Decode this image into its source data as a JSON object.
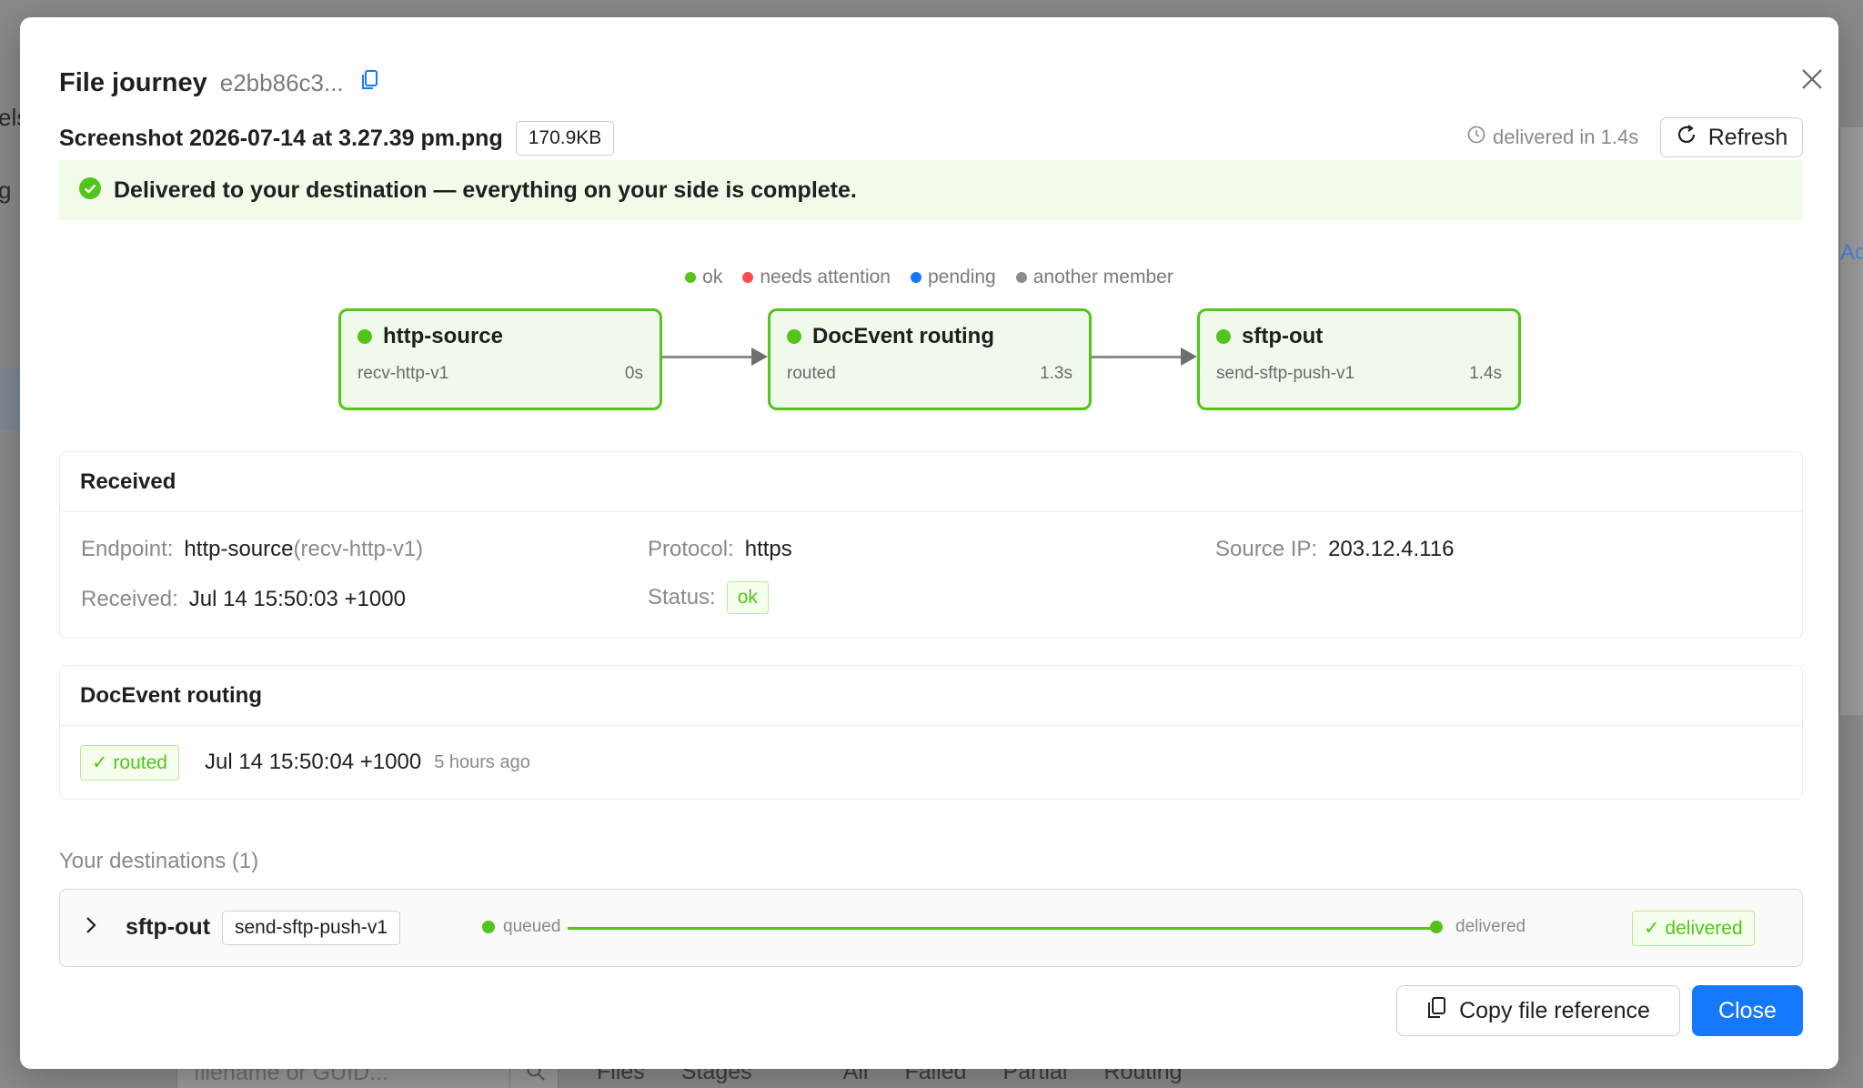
{
  "background": {
    "side_fragments": [
      "els",
      "g"
    ],
    "right_fragment": "Ad",
    "search_placeholder": "filename or GUID...",
    "tabs": [
      "Files",
      "Stages",
      "All",
      "Failed",
      "Partial",
      "Routing"
    ]
  },
  "modal": {
    "title": "File journey",
    "file_id": "e2bb86c3...",
    "file_name": "Screenshot 2026-07-14 at 3.27.39 pm.png",
    "file_size": "170.9KB",
    "delivered_in": "delivered in 1.4s",
    "refresh_label": "Refresh",
    "banner": "Delivered to your destination — everything on your side is complete."
  },
  "legend": [
    {
      "label": "ok",
      "color": "#52c41a"
    },
    {
      "label": "needs attention",
      "color": "#ff4d4f"
    },
    {
      "label": "pending",
      "color": "#1677ff"
    },
    {
      "label": "another member",
      "color": "#8c8c8c"
    }
  ],
  "flow": [
    {
      "title": "http-source",
      "subtitle": "recv-http-v1",
      "time": "0s",
      "status_color": "#52c41a"
    },
    {
      "title": "DocEvent routing",
      "subtitle": "routed",
      "time": "1.3s",
      "status_color": "#52c41a"
    },
    {
      "title": "sftp-out",
      "subtitle": "send-sftp-push-v1",
      "time": "1.4s",
      "status_color": "#52c41a"
    }
  ],
  "received": {
    "heading": "Received",
    "endpoint_label": "Endpoint",
    "endpoint_value": "http-source",
    "endpoint_sub": "(recv-http-v1)",
    "protocol_label": "Protocol",
    "protocol_value": "https",
    "source_ip_label": "Source IP",
    "source_ip_value": "203.12.4.116",
    "received_label": "Received",
    "received_value": "Jul 14 15:50:03 +1000",
    "status_label": "Status",
    "status_value": "ok"
  },
  "routing": {
    "heading": "DocEvent routing",
    "tag": "✓ routed",
    "time": "Jul 14 15:50:04 +1000",
    "ago": "5 hours ago"
  },
  "destinations": {
    "title": "Your destinations (1)",
    "items": [
      {
        "name": "sftp-out",
        "badge": "send-sftp-push-v1",
        "start_label": "queued",
        "end_label": "delivered",
        "status": "✓ delivered"
      }
    ]
  },
  "footer": {
    "copy_label": "Copy file reference",
    "close_label": "Close"
  },
  "colors": {
    "ok": "#52c41a",
    "primary": "#1677ff",
    "banner_bg": "#f2fbe9"
  }
}
